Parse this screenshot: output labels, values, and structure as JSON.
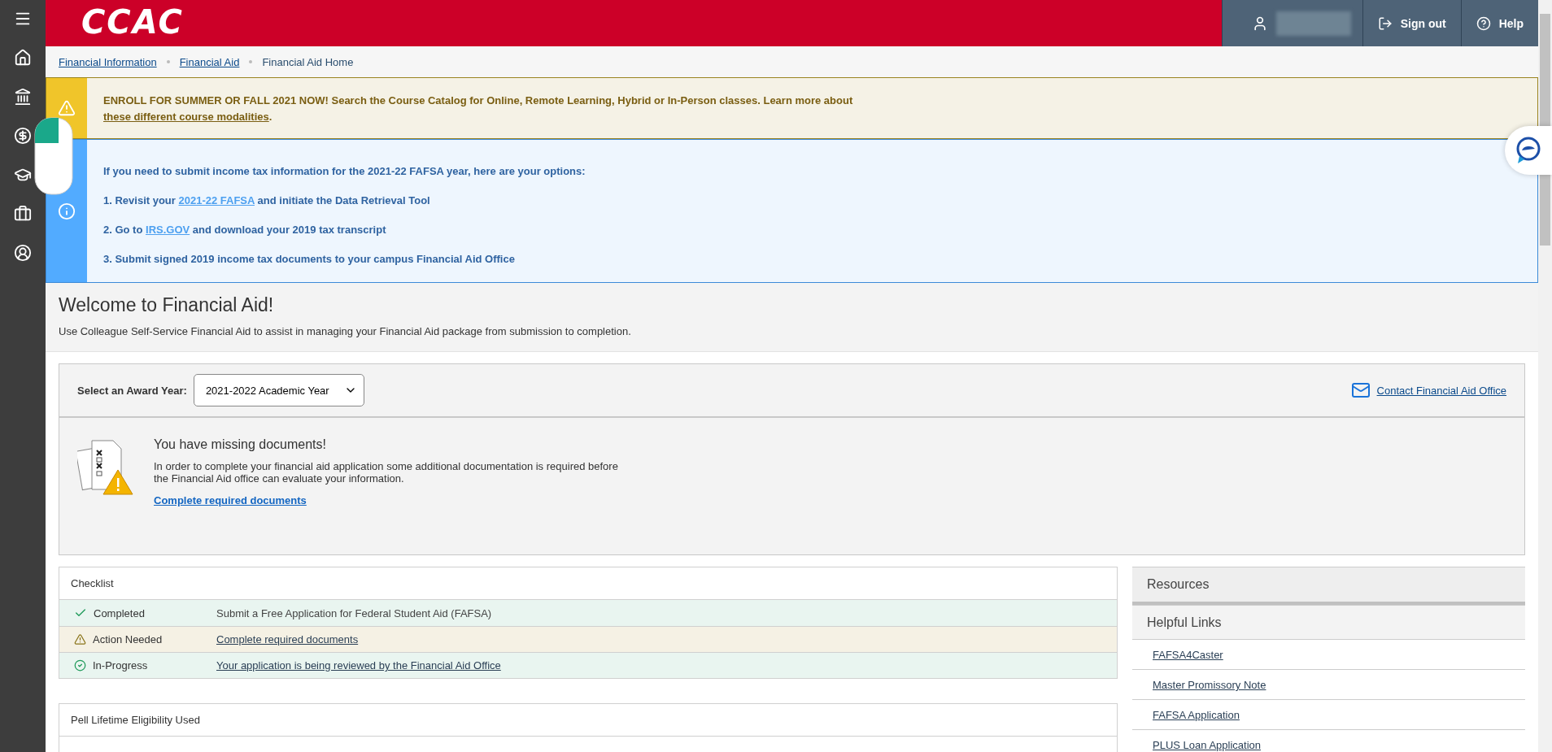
{
  "header": {
    "logo": "CCAC",
    "actions": [
      {
        "kind": "user"
      },
      {
        "kind": "signout",
        "label": "Sign out"
      },
      {
        "kind": "help",
        "label": "Help"
      }
    ]
  },
  "sidebar": {
    "items": [
      {
        "kind": "menu"
      },
      {
        "kind": "home"
      },
      {
        "kind": "bank"
      },
      {
        "kind": "money"
      },
      {
        "kind": "cap"
      },
      {
        "kind": "briefcase"
      },
      {
        "kind": "user"
      }
    ]
  },
  "breadcrumbs": [
    {
      "label": "Financial Information",
      "link": true
    },
    {
      "label": "Financial Aid",
      "link": true
    },
    {
      "label": "Financial Aid Home",
      "link": false
    }
  ],
  "alert_banner": {
    "text": "**ENROLL FOR SUMMER OR FALL 2021 NOW!** Search the Course Catalog for Online, Remote Learning, Hybrid or In-Person classes. Learn more about",
    "link": "these different course modalities",
    "after": "."
  },
  "info_banner": {
    "lines": [
      {
        "before": "If you need to submit income tax information for the 2021-22 FAFSA year, here are your options:"
      },
      {
        "before": "1. Revisit your",
        "link": "2021-22 FAFSA",
        "after": "and initiate the Data Retrieval Tool"
      },
      {
        "before": "2. Go to",
        "link": "IRS.GOV",
        "after": "and download your 2019 tax transcript"
      },
      {
        "before": "3. Submit signed 2019 income tax documents to your campus Financial Aid Office"
      }
    ]
  },
  "welcome": {
    "title": "Welcome to Financial Aid!",
    "description": "Use Colleague Self-Service Financial Aid to assist in managing your Financial Aid package from submission to completion."
  },
  "award_year": {
    "label": "Select an Award Year:",
    "value": "2021-2022 Academic Year",
    "contact_link": "Contact Financial Aid Office"
  },
  "missing_documents": {
    "title": "You have missing documents!",
    "text": "In order to complete your financial aid application some additional documentation is required before the Financial Aid office can evaluate your information.",
    "link": "Complete required documents"
  },
  "checklist": {
    "title": "Checklist",
    "rows": [
      {
        "kind": "completed",
        "status": "Completed",
        "text": "Submit a Free Application for Federal Student Aid (FAFSA)",
        "link": false
      },
      {
        "kind": "action",
        "status": "Action Needed",
        "text": "Complete required documents",
        "link": true
      },
      {
        "kind": "progress",
        "status": "In-Progress",
        "text": "Your application is being reviewed by the Financial Aid Office",
        "link": true
      }
    ]
  },
  "pell": {
    "title": "Pell Lifetime Eligibility Used"
  },
  "resources": {
    "title": "Resources",
    "subtitle": "Helpful Links",
    "links": [
      "FAFSA4Caster",
      "Master Promissory Note",
      "FAFSA Application",
      "PLUS Loan Application"
    ]
  }
}
